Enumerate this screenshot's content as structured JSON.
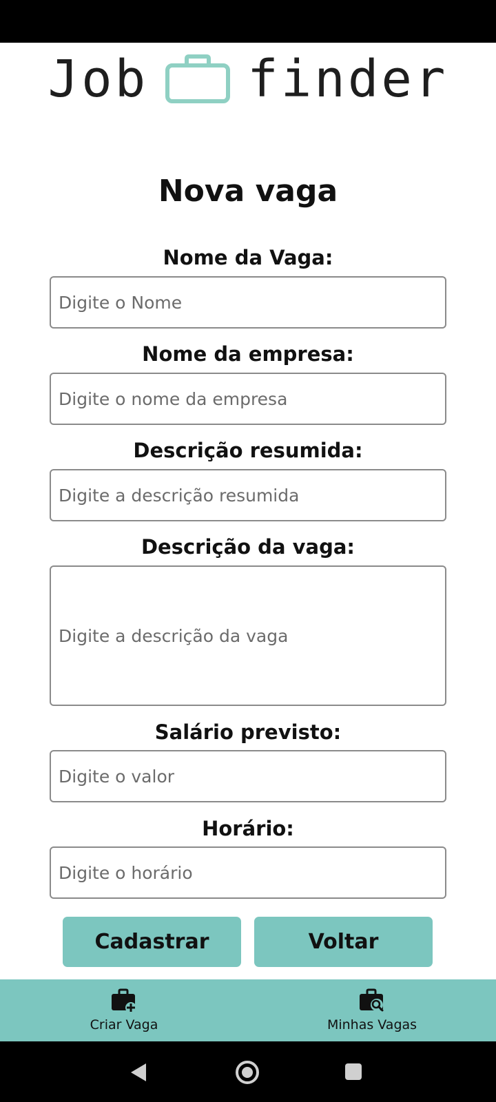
{
  "app": {
    "logo_left": "Job",
    "logo_right": "finder",
    "title": "Nova vaga"
  },
  "form": {
    "fields": [
      {
        "label": "Nome da Vaga:",
        "placeholder": "Digite o Nome"
      },
      {
        "label": "Nome da empresa:",
        "placeholder": "Digite o nome da empresa"
      },
      {
        "label": "Descrição resumida:",
        "placeholder": "Digite a descrição resumida"
      },
      {
        "label": "Descrição da vaga:",
        "placeholder": "Digite a descrição da vaga"
      },
      {
        "label": "Salário previsto:",
        "placeholder": "Digite o valor"
      },
      {
        "label": "Horário:",
        "placeholder": "Digite o horário"
      }
    ],
    "submit_label": "Cadastrar",
    "back_label": "Voltar"
  },
  "bottom_nav": {
    "items": [
      {
        "label": "Criar Vaga",
        "icon": "briefcase-plus-icon"
      },
      {
        "label": "Minhas Vagas",
        "icon": "briefcase-search-icon"
      }
    ]
  },
  "colors": {
    "accent": "#7cc6bf",
    "logo_bag": "#8fd0c3",
    "text": "#111111",
    "placeholder": "#6b6b6b"
  },
  "system_nav": {
    "icons": [
      "back-icon",
      "home-icon",
      "recents-icon"
    ]
  }
}
